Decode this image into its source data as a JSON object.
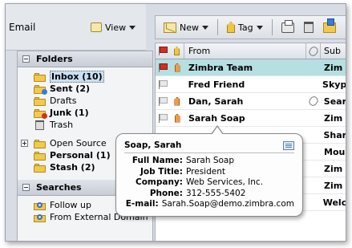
{
  "app": {
    "title": "Email"
  },
  "header": {
    "view_label": "View"
  },
  "sidebar": {
    "folders_header": "Folders",
    "folders": [
      {
        "label": "Inbox (10)",
        "bold": true,
        "selected": true
      },
      {
        "label": "Sent (2)",
        "bold": true
      },
      {
        "label": "Drafts",
        "bold": false
      },
      {
        "label": "Junk (1)",
        "bold": true
      },
      {
        "label": "Trash",
        "bold": false
      },
      {
        "label": "Open Source",
        "bold": false
      },
      {
        "label": "Personal (1)",
        "bold": true
      },
      {
        "label": "Stash (2)",
        "bold": true
      }
    ],
    "searches_header": "Searches",
    "searches": [
      {
        "label": "Follow up"
      },
      {
        "label": "From External Domain"
      }
    ]
  },
  "toolbar": {
    "new_label": "New",
    "tag_label": "Tag"
  },
  "list": {
    "col_from": "From",
    "col_subject": "Sub",
    "rows": [
      {
        "from": "Zimbra Team",
        "subject": "Zim",
        "unread": true,
        "selected": true,
        "flag": "red",
        "tag": "orange",
        "attach": false
      },
      {
        "from": "Fred Friend",
        "subject": "Skyp",
        "unread": true,
        "selected": false,
        "flag": "grey",
        "tag": "",
        "attach": false
      },
      {
        "from": "Dan, Sarah",
        "subject": "Sear",
        "unread": true,
        "selected": false,
        "flag": "grey",
        "tag": "orange",
        "attach": true
      },
      {
        "from": "Sarah Soap",
        "subject": "Zim",
        "unread": true,
        "selected": false,
        "flag": "grey",
        "tag": "orange",
        "attach": false
      },
      {
        "from": "",
        "subject": "Shar",
        "unread": true,
        "selected": false,
        "flag": "",
        "tag": "",
        "attach": false
      },
      {
        "from": "",
        "subject": "Mou",
        "unread": true,
        "selected": false,
        "flag": "",
        "tag": "",
        "attach": false
      },
      {
        "from": "",
        "subject": "Zim",
        "unread": true,
        "selected": false,
        "flag": "",
        "tag": "",
        "attach": false
      },
      {
        "from": "",
        "subject": "Zim",
        "unread": true,
        "selected": false,
        "flag": "",
        "tag": "",
        "attach": false
      },
      {
        "from": "",
        "subject": "Welc",
        "unread": true,
        "selected": false,
        "flag": "",
        "tag": "",
        "attach": false
      }
    ]
  },
  "tooltip": {
    "title": "Soap, Sarah",
    "fields": [
      {
        "key": "Full Name:",
        "value": "Sarah Soap"
      },
      {
        "key": "Job Title:",
        "value": "President"
      },
      {
        "key": "Company:",
        "value": "Web Services, Inc."
      },
      {
        "key": "Phone:",
        "value": "312-555-5402"
      },
      {
        "key": "E-mail:",
        "value": "Sarah.Soap@demo.zimbra.com"
      }
    ]
  }
}
